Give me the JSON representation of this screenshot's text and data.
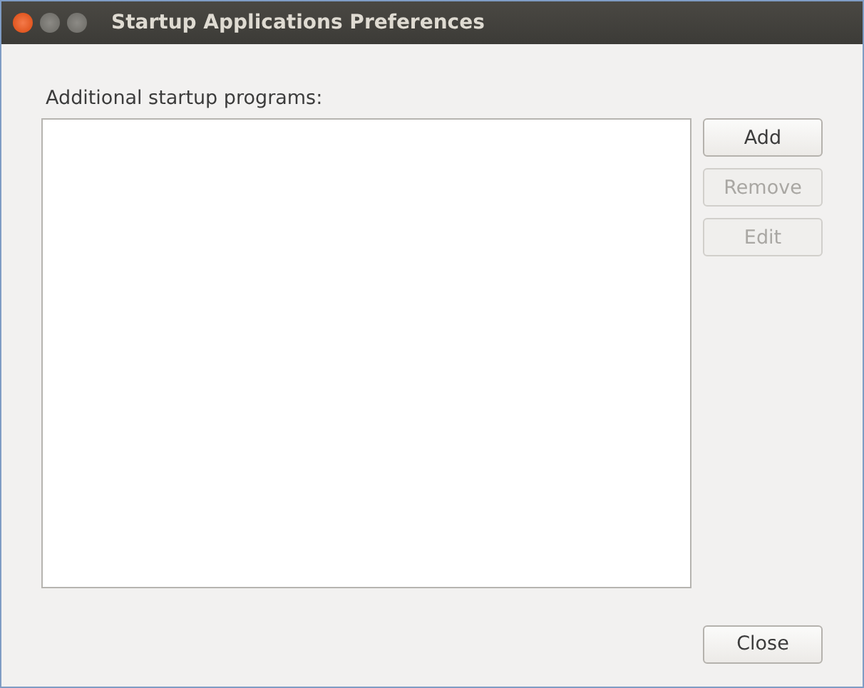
{
  "window": {
    "title": "Startup Applications Preferences"
  },
  "list": {
    "label": "Additional startup programs:"
  },
  "side_buttons": [
    {
      "label": "Add",
      "disabled": false
    },
    {
      "label": "Remove",
      "disabled": true
    },
    {
      "label": "Edit",
      "disabled": true
    }
  ],
  "footer_buttons": [
    {
      "label": "Close",
      "disabled": false
    }
  ]
}
